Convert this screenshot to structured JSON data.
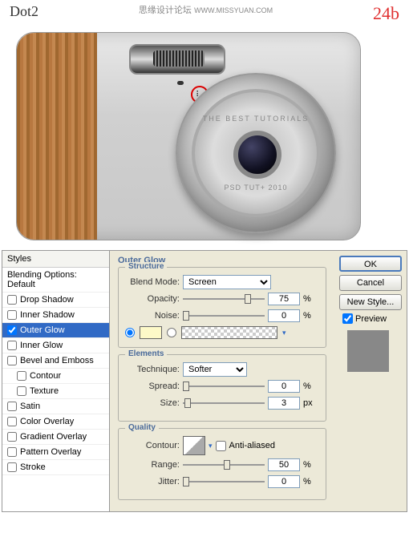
{
  "header": {
    "left": "Dot2",
    "watermark": "思缘设计论坛",
    "watermark_url": "WWW.MISSYUAN.COM",
    "right": "24b"
  },
  "camera": {
    "text_top": "THE BEST TUTORIALS",
    "text_bottom": "PSD TUT+ 2010"
  },
  "styles": {
    "header": "Styles",
    "blending_opts": "Blending Options: Default",
    "items": [
      {
        "label": "Drop Shadow",
        "checked": false
      },
      {
        "label": "Inner Shadow",
        "checked": false
      },
      {
        "label": "Outer Glow",
        "checked": true,
        "selected": true
      },
      {
        "label": "Inner Glow",
        "checked": false
      },
      {
        "label": "Bevel and Emboss",
        "checked": false
      },
      {
        "label": "Contour",
        "checked": false,
        "sub": true
      },
      {
        "label": "Texture",
        "checked": false,
        "sub": true
      },
      {
        "label": "Satin",
        "checked": false
      },
      {
        "label": "Color Overlay",
        "checked": false
      },
      {
        "label": "Gradient Overlay",
        "checked": false
      },
      {
        "label": "Pattern Overlay",
        "checked": false
      },
      {
        "label": "Stroke",
        "checked": false
      }
    ]
  },
  "panel": {
    "title": "Outer Glow",
    "structure": {
      "legend": "Structure",
      "blend_mode_label": "Blend Mode:",
      "blend_mode_value": "Screen",
      "opacity_label": "Opacity:",
      "opacity_value": "75",
      "opacity_unit": "%",
      "noise_label": "Noise:",
      "noise_value": "0",
      "noise_unit": "%",
      "glow_color": "#fdf9c8"
    },
    "elements": {
      "legend": "Elements",
      "technique_label": "Technique:",
      "technique_value": "Softer",
      "spread_label": "Spread:",
      "spread_value": "0",
      "spread_unit": "%",
      "size_label": "Size:",
      "size_value": "3",
      "size_unit": "px"
    },
    "quality": {
      "legend": "Quality",
      "contour_label": "Contour:",
      "antialiased_label": "Anti-aliased",
      "antialiased_checked": false,
      "range_label": "Range:",
      "range_value": "50",
      "range_unit": "%",
      "jitter_label": "Jitter:",
      "jitter_value": "0",
      "jitter_unit": "%"
    }
  },
  "buttons": {
    "ok": "OK",
    "cancel": "Cancel",
    "new_style": "New Style...",
    "preview": "Preview"
  }
}
